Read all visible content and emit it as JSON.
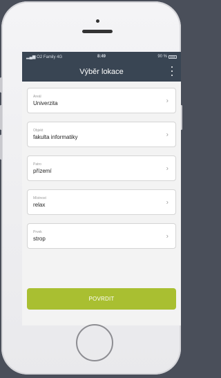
{
  "status_bar": {
    "carrier": "O2 Family  4G",
    "time": "8:49",
    "battery": "90 %"
  },
  "header": {
    "title": "Výběr lokace"
  },
  "fields": [
    {
      "label": "Areál",
      "value": "Univerzita"
    },
    {
      "label": "Objekt",
      "value": "fakulta informatiky"
    },
    {
      "label": "Patro",
      "value": "přízemí"
    },
    {
      "label": "Místnost",
      "value": "relax"
    },
    {
      "label": "Prvek",
      "value": "strop"
    }
  ],
  "actions": {
    "confirm_label": "POVRDIT"
  },
  "colors": {
    "header_bg": "#394553",
    "confirm_bg": "#a9bf31",
    "page_bg": "#4a4f5a"
  },
  "icons": [
    "chevron-right-icon",
    "more-vertical-icon",
    "signal-icon",
    "battery-icon"
  ]
}
